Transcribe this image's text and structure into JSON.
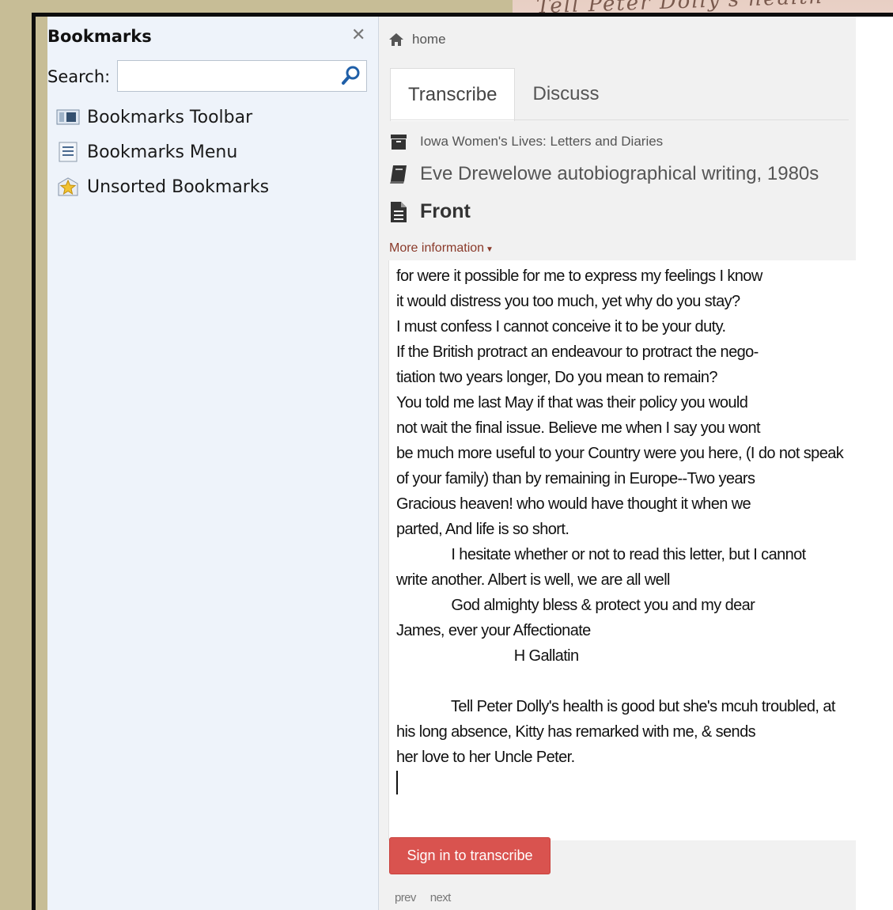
{
  "sidebar": {
    "title": "Bookmarks",
    "search_label": "Search:",
    "search_value": "",
    "items": [
      {
        "label": "Bookmarks Toolbar",
        "icon": "bookmarks-toolbar-icon"
      },
      {
        "label": "Bookmarks Menu",
        "icon": "bookmarks-menu-icon"
      },
      {
        "label": "Unsorted Bookmarks",
        "icon": "unsorted-bookmarks-icon"
      }
    ]
  },
  "breadcrumb": {
    "home": "home"
  },
  "tabs": [
    {
      "label": "Transcribe",
      "active": true
    },
    {
      "label": "Discuss",
      "active": false
    }
  ],
  "meta": {
    "collection": "Iowa Women's Lives: Letters and Diaries",
    "item": "Eve Drewelowe autobiographical writing, 1980s",
    "page": "Front",
    "more_info": "More information"
  },
  "transcription": [
    "for were it possible for me to express my feelings I know",
    "it would distress you too much, yet why do you stay?",
    "I must confess I cannot conceive it to be your duty.",
    "If the British protract an endeavour to protract the nego-",
    "tiation two years longer, Do you mean to remain?",
    "You told me last May if that was their policy you would",
    "not wait the final issue. Believe me when I say you wont",
    "be much more useful to your Country were you here, (I do not speak",
    "of your family) than by remaining in Europe--Two years",
    "Gracious heaven! who would have thought it when we",
    "parted, And life is so short.",
    "              I hesitate whether or not to read this letter, but I cannot",
    "write another. Albert is well, we are all well",
    "              God almighty bless & protect you and my dear",
    "James, ever your Affectionate",
    "                              H Gallatin",
    "",
    "              Tell Peter Dolly's health is good but she's mcuh troubled, at",
    "his long absence, Kitty has remarked with me, & sends",
    "her love to her Uncle Peter."
  ],
  "actions": {
    "signin": "Sign in to transcribe"
  },
  "pager": {
    "prev": "prev",
    "next": "next"
  },
  "colors": {
    "accent_red": "#d9534f",
    "link_brown": "#8a3a2a",
    "backdrop": "#c7bd96"
  }
}
